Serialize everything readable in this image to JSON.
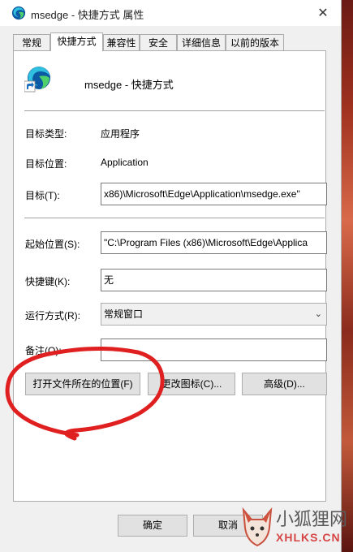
{
  "window": {
    "title": "msedge - 快捷方式 属性",
    "close_glyph": "✕"
  },
  "tabs": [
    {
      "label": "常规"
    },
    {
      "label": "快捷方式"
    },
    {
      "label": "兼容性"
    },
    {
      "label": "安全"
    },
    {
      "label": "详细信息"
    },
    {
      "label": "以前的版本"
    }
  ],
  "app": {
    "name": "msedge - 快捷方式",
    "icon": "edge-shortcut-icon"
  },
  "fields": {
    "target_type_label": "目标类型:",
    "target_type_value": "应用程序",
    "target_location_label": "目标位置:",
    "target_location_value": "Application",
    "target_label": "目标(T):",
    "target_value": "x86)\\Microsoft\\Edge\\Application\\msedge.exe\"",
    "start_in_label": "起始位置(S):",
    "start_in_value": "\"C:\\Program Files (x86)\\Microsoft\\Edge\\Applica",
    "shortcut_key_label": "快捷键(K):",
    "shortcut_key_value": "无",
    "run_label": "运行方式(R):",
    "run_value": "常规窗口",
    "comment_label": "备注(O):",
    "comment_value": ""
  },
  "buttons": {
    "open_location": "打开文件所在的位置(F)",
    "change_icon": "更改图标(C)...",
    "advanced": "高级(D)...",
    "ok": "确定",
    "cancel": "取消"
  },
  "watermark": {
    "line1": "小狐狸网",
    "line2": "XHLKS.CN"
  },
  "colors": {
    "accent": "#0078d7",
    "annotation": "#e02020"
  }
}
